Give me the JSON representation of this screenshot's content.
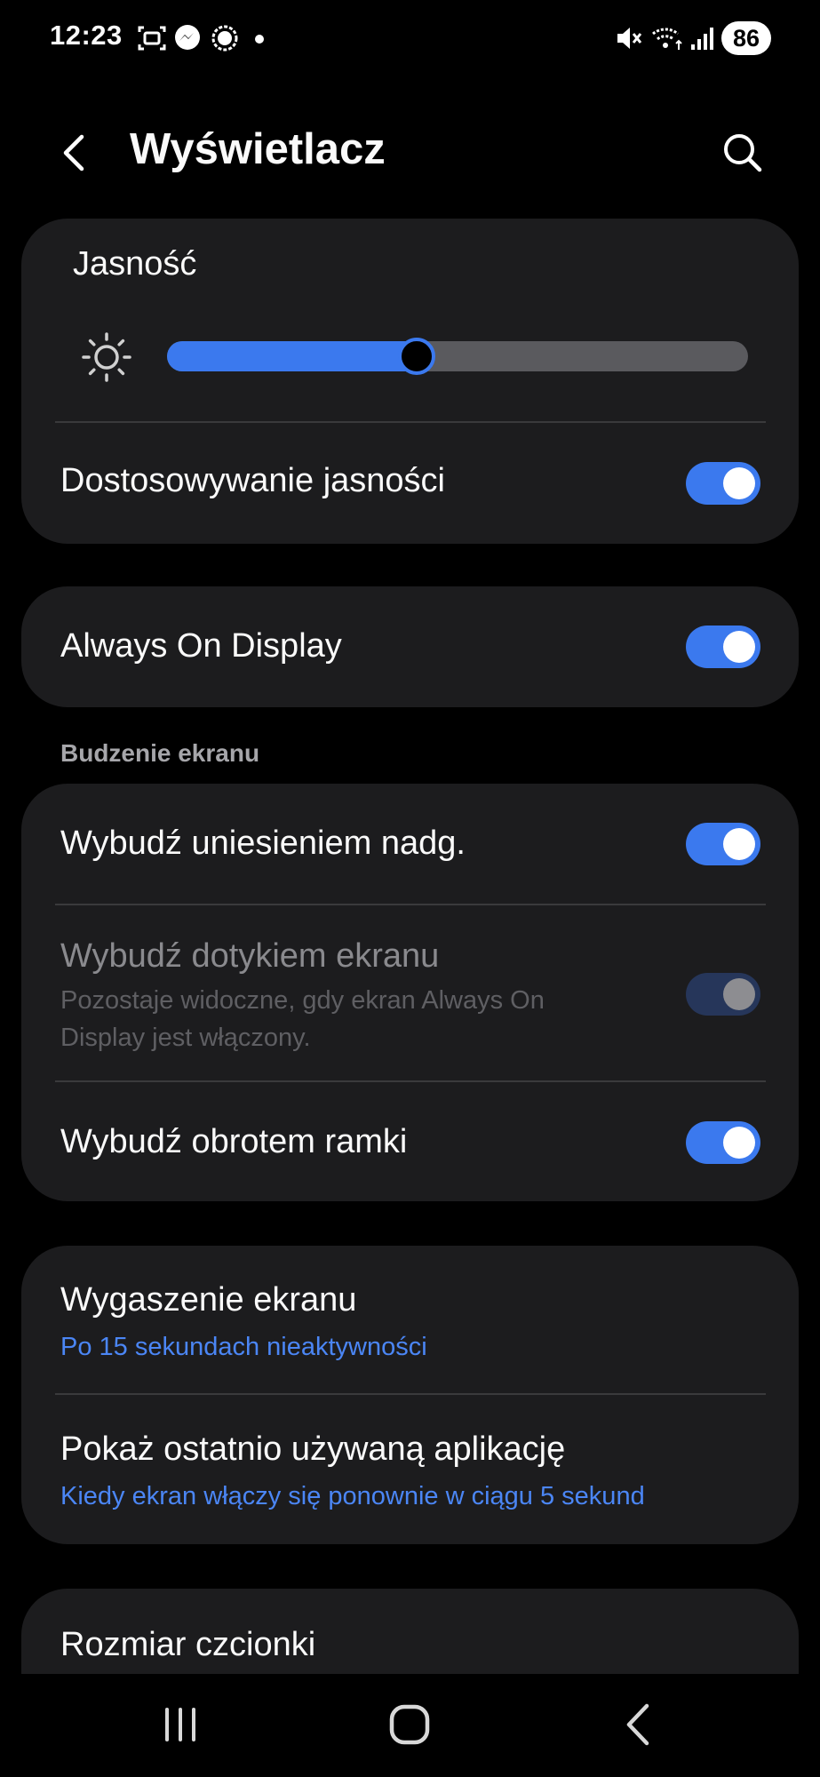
{
  "status_bar": {
    "time": "12:23",
    "battery": "86",
    "left_icons": [
      "screenshot-icon",
      "messenger-icon",
      "signal-app-icon",
      "dot-icon"
    ],
    "right_icons": [
      "mute-icon",
      "wifi-icon",
      "cell-signal-icon"
    ]
  },
  "header": {
    "title": "Wyświetlacz",
    "back_icon": "back-arrow-icon",
    "search_icon": "search-icon"
  },
  "brightness": {
    "label": "Jasność",
    "level_fraction": 0.43,
    "adaptive_label": "Dostosowywanie jasności",
    "adaptive_on": true
  },
  "aod": {
    "label": "Always On Display",
    "on": true
  },
  "wake": {
    "section_label": "Budzenie ekranu",
    "lift_label": "Wybudź uniesieniem nadg.",
    "lift_on": true,
    "tap_label": "Wybudź dotykiem ekranu",
    "tap_desc": "Pozostaje widoczne, gdy ekran Always On Display jest włączony.",
    "tap_on": true,
    "tap_enabled": false,
    "bezel_label": "Wybudź obrotem ramki",
    "bezel_on": true
  },
  "timeout": {
    "label": "Wygaszenie ekranu",
    "value": "Po 15 sekundach nieaktywności",
    "recent_label": "Pokaż ostatnio używaną aplikację",
    "recent_value": "Kiedy ekran włączy się ponownie w ciągu 5 sekund"
  },
  "font": {
    "label": "Rozmiar czcionki"
  },
  "colors": {
    "accent": "#3b79ee",
    "card": "#1c1c1e",
    "link": "#4b86f5"
  },
  "nav_bar": {
    "icons": [
      "recents-icon",
      "home-icon",
      "back-nav-icon"
    ]
  }
}
